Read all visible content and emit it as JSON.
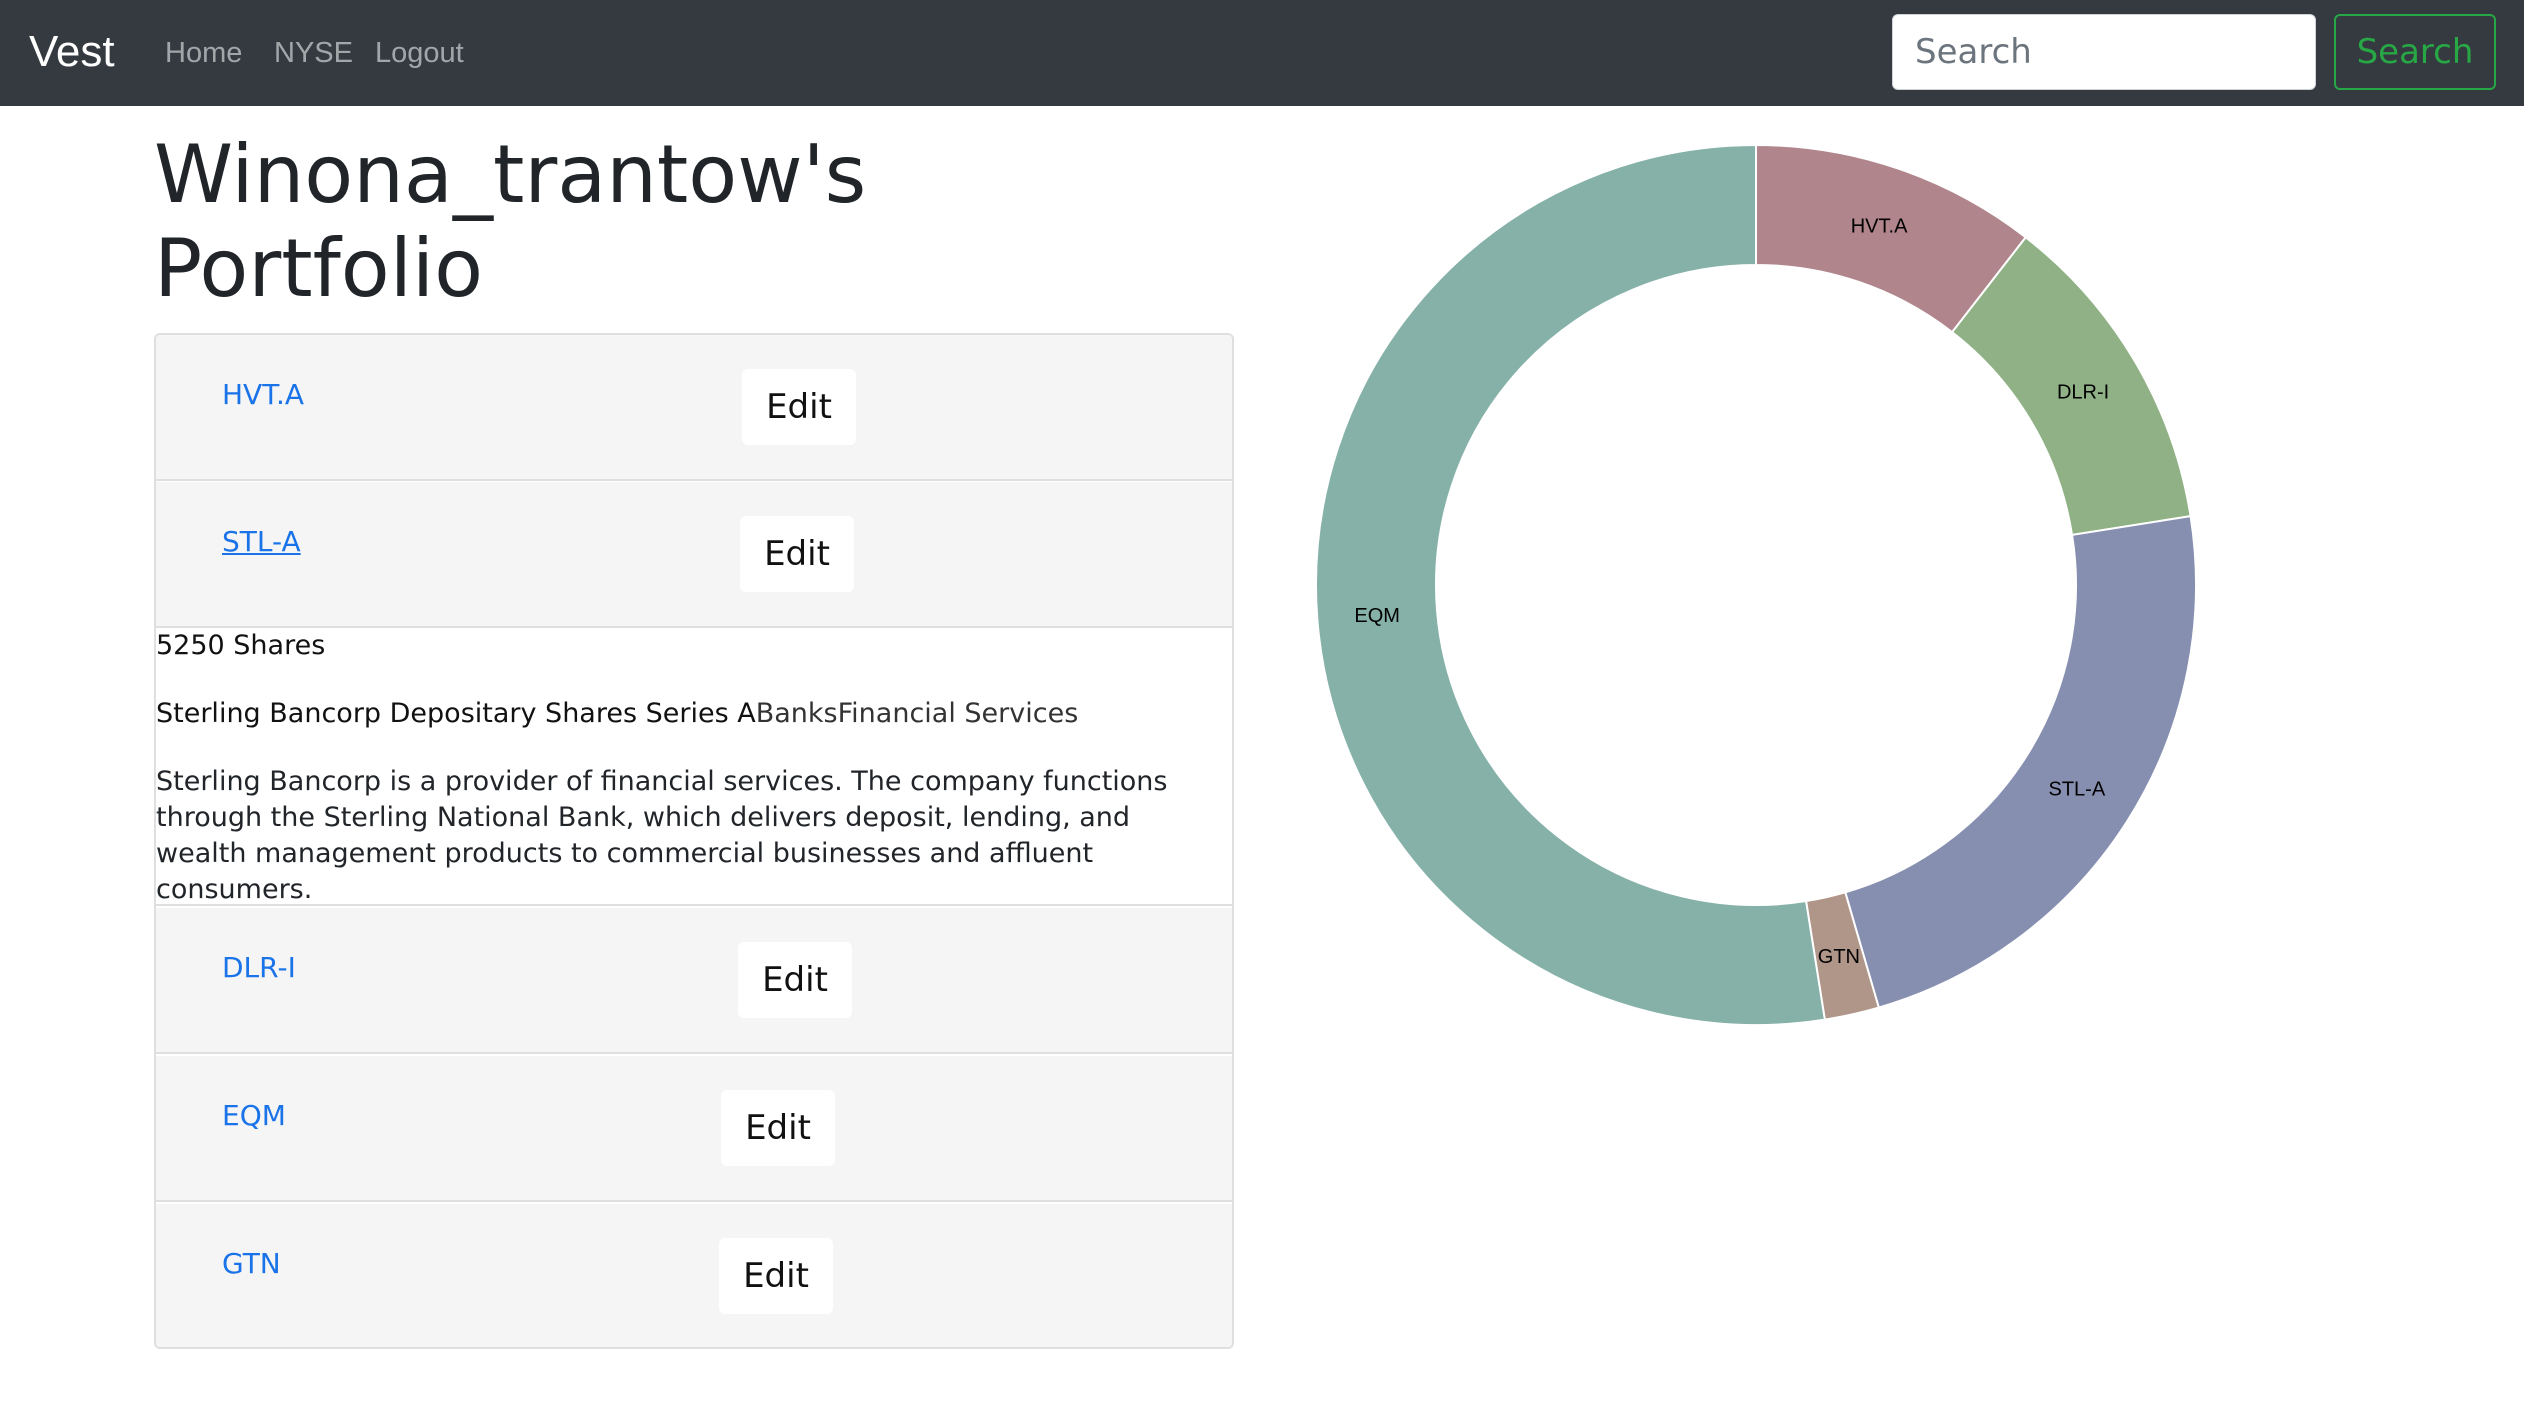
{
  "navbar": {
    "brand": "Vest",
    "links": [
      "Home",
      "NYSE",
      "Logout"
    ],
    "search_placeholder": "Search",
    "search_button": "Search"
  },
  "page": {
    "title": "Winona_trantow's Portfolio"
  },
  "holdings": [
    {
      "ticker": "HVT.A",
      "edit_label": "Edit"
    },
    {
      "ticker": "STL-A",
      "edit_label": "Edit"
    },
    {
      "ticker": "DLR-I",
      "edit_label": "Edit"
    },
    {
      "ticker": "EQM",
      "edit_label": "Edit"
    },
    {
      "ticker": "GTN",
      "edit_label": "Edit"
    }
  ],
  "expanded": {
    "shares": "5250 Shares",
    "company_name": "Sterling Bancorp Depositary Shares Series A",
    "industry": "Banks",
    "sector": "Financial Services",
    "description": "Sterling Bancorp is a provider of financial services. The company functions through the Sterling National Bank, which delivers deposit, lending, and wealth management products to commercial businesses and affluent consumers."
  },
  "chart_data": {
    "type": "pie",
    "donut": true,
    "labels": [
      "HVT.A",
      "DLR-I",
      "STL-A",
      "GTN",
      "EQM"
    ],
    "values": [
      10.5,
      12.0,
      23.0,
      2.0,
      52.5
    ],
    "colors": [
      "#b0858b",
      "#8fb185",
      "#878fb1",
      "#b09589",
      "#86b1a8"
    ]
  }
}
